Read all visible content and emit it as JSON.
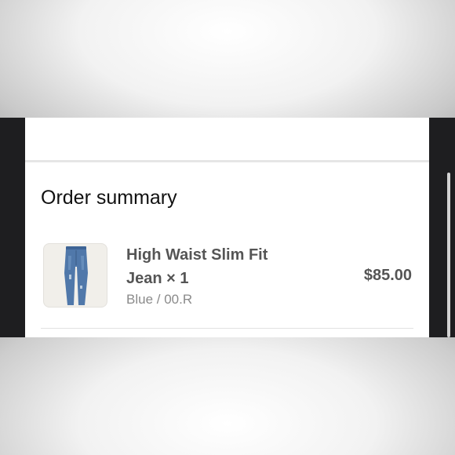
{
  "order_summary": {
    "title": "Order summary",
    "item": {
      "image": "jeans-image",
      "name": "High Waist Slim Fit Jean × 1",
      "variant": "Blue / 00.R",
      "price": "$85.00"
    }
  },
  "colors": {
    "page_background": "#ffffff",
    "device_frame": "#1e1e20",
    "denim": "#4f76a8"
  }
}
